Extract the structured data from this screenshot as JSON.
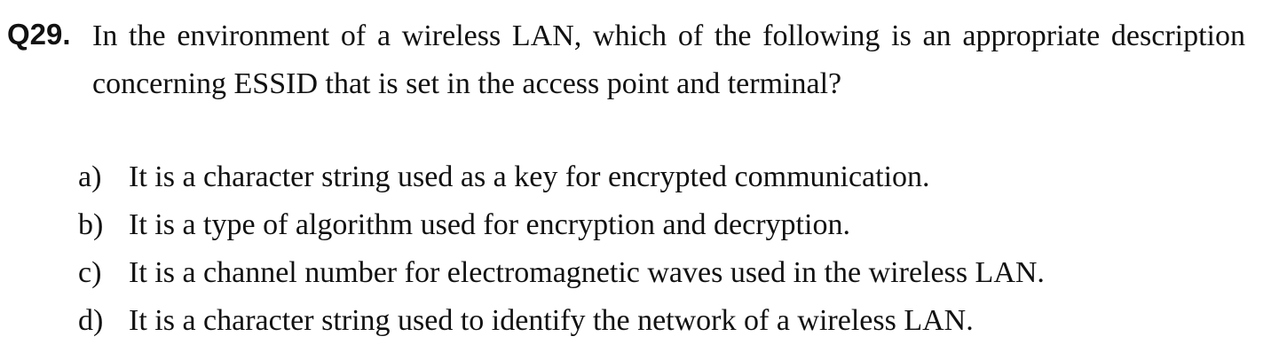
{
  "question": {
    "number": "Q29.",
    "text": "In the environment of a wireless LAN, which of the following is an appropriate description concerning ESSID that is set in the access point and terminal?"
  },
  "options": [
    {
      "letter": "a)",
      "text": "It is a character string used as a key for encrypted communication."
    },
    {
      "letter": "b)",
      "text": "It is a type of algorithm used for encryption and decryption."
    },
    {
      "letter": "c)",
      "text": "It is a channel number for electromagnetic waves used in the wireless LAN."
    },
    {
      "letter": "d)",
      "text": "It is a character string used to identify the network of a wireless LAN."
    }
  ]
}
